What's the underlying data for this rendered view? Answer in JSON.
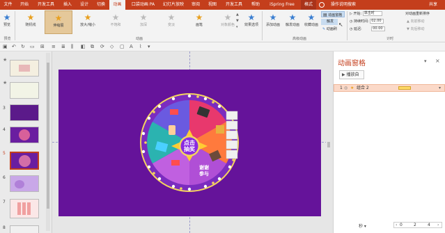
{
  "tabs": [
    "文件",
    "开始",
    "开发工具",
    "插入",
    "设计",
    "切换",
    "动画",
    "口袋动画 PA",
    "幻灯片放映",
    "审阅",
    "视图",
    "开发工具",
    "帮助",
    "iSpring Free",
    "格式",
    "操作说明搜索",
    "共享"
  ],
  "ribbon": {
    "preview": "预览",
    "effects": [
      "随机线",
      "伸缩展",
      "放大/缩小",
      "不饱和",
      "加深",
      "变淡",
      "画笔",
      "对象颜色"
    ],
    "effect_options": "效果选项",
    "add_animation": "添加动画",
    "trigger_btns": [
      "触发动画",
      "收藏动画"
    ],
    "anim_pane": "动画窗格",
    "trigger": "触发",
    "anim_painter": "动画刷",
    "start_label": "开始:",
    "start_value": "单击时",
    "duration_label": "持续时间:",
    "duration_value": "02.00",
    "delay_label": "延迟:",
    "delay_value": "00.00",
    "reorder_title": "对动画重新排序",
    "move_earlier": "向前移动",
    "move_later": "向后移动",
    "groups": [
      "预览",
      "动画",
      "高级动画",
      "计时"
    ]
  },
  "slide_numbers": [
    "1",
    "2",
    "3",
    "4",
    "5",
    "6",
    "7",
    "8"
  ],
  "wheel": {
    "center_text_line1": "点击",
    "center_text_line2": "抽奖",
    "segment_label_line1": "谢谢",
    "segment_label_line2": "参与"
  },
  "pane": {
    "title": "动画窗格",
    "play_btn": "播放自",
    "item_index": "1",
    "item_name": "组合 2",
    "seconds_label": "秒 ▾",
    "timeline_ticks": [
      "0",
      "2",
      "4"
    ]
  },
  "colors": {
    "accent": "#c43e1c",
    "slide_bg": "#65139a"
  }
}
